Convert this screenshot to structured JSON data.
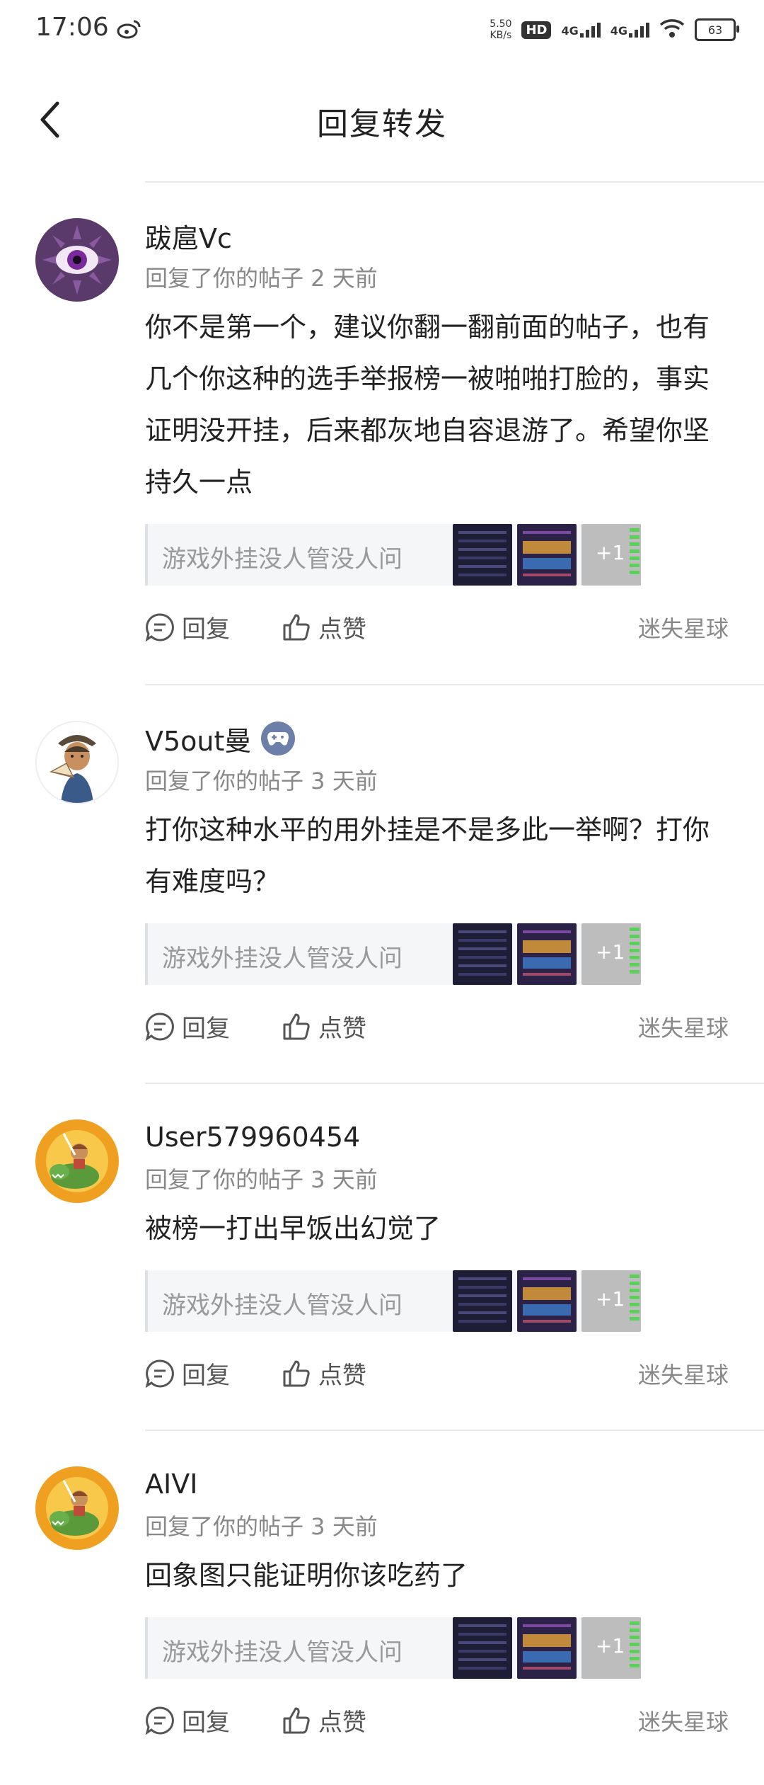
{
  "status_bar": {
    "time": "17:06",
    "net_speed_value": "5.50",
    "net_speed_unit": "KB/s",
    "hd_label": "HD",
    "signal1_label": "4G",
    "signal2_label": "4G",
    "battery": "63"
  },
  "header": {
    "title": "回复转发"
  },
  "replies": [
    {
      "username": "跋扈Vc",
      "meta": "回复了你的帖子 2 天前",
      "text": "你不是第一个，建议你翻一翻前面的帖子，也有几个你这种的选手举报榜一被啪啪打脸的，事实证明没开挂，后来都灰地自容退游了。希望你坚持久一点",
      "quote": "游戏外挂没人管没人问",
      "more_count": "+1",
      "reply_label": "回复",
      "like_label": "点赞",
      "post_author": "迷失星球"
    },
    {
      "username": "V5out曼",
      "meta": "回复了你的帖子 3 天前",
      "text": "打你这种水平的用外挂是不是多此一举啊？打你有难度吗？",
      "quote": "游戏外挂没人管没人问",
      "more_count": "+1",
      "reply_label": "回复",
      "like_label": "点赞",
      "post_author": "迷失星球"
    },
    {
      "username": "User579960454",
      "meta": "回复了你的帖子 3 天前",
      "text": "被榜一打出早饭出幻觉了",
      "quote": "游戏外挂没人管没人问",
      "more_count": "+1",
      "reply_label": "回复",
      "like_label": "点赞",
      "post_author": "迷失星球"
    },
    {
      "username": "AIVI",
      "meta": "回复了你的帖子 3 天前",
      "text": "回象图只能证明你该吃药了",
      "quote": "游戏外挂没人管没人问",
      "more_count": "+1",
      "reply_label": "回复",
      "like_label": "点赞",
      "post_author": "迷失星球"
    }
  ]
}
